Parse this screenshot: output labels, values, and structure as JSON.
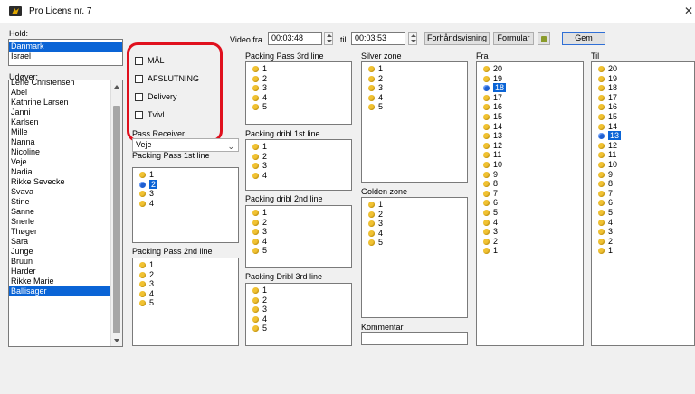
{
  "window": {
    "title": "Pro Licens nr. 7",
    "close_glyph": "✕"
  },
  "hold": {
    "label": "Hold:",
    "items": [
      "Danmark",
      "Israel"
    ],
    "selected_index": 0
  },
  "udover": {
    "label": "Udøver:",
    "items": [
      "Lene Christensen",
      "Abel",
      "Kathrine Larsen",
      "Janni",
      "Karlsen",
      "Mille",
      "Nanna",
      "Nicoline",
      "Veje",
      "Nadia",
      "Rikke Sevecke",
      "Svava",
      "Stine",
      "Sanne",
      "Snerle",
      "Thøger",
      "Sara",
      "Junge",
      "Bruun",
      "Harder",
      "Rikke Marie",
      "Ballisager"
    ],
    "selected_index": 21
  },
  "checkboxes": [
    {
      "label": "MÅL",
      "checked": false
    },
    {
      "label": "AFSLUTNING",
      "checked": false
    },
    {
      "label": "Delivery",
      "checked": false
    },
    {
      "label": "Tvivl",
      "checked": false
    }
  ],
  "pass_receiver": {
    "label": "Pass Receiver",
    "value": "Veje"
  },
  "video": {
    "from_label": "Video fra",
    "from_value": "00:03:48",
    "to_label": "til",
    "to_value": "00:03:53"
  },
  "buttons": {
    "preview": "Forhåndsvisning",
    "form": "Formular",
    "save": "Gem"
  },
  "groups": {
    "pp1": {
      "label": "Packing Pass 1st line",
      "items": [
        "1",
        "2",
        "3",
        "4"
      ],
      "selected_index": 1
    },
    "pp2": {
      "label": "Packing Pass 2nd line",
      "items": [
        "1",
        "2",
        "3",
        "4",
        "5"
      ],
      "selected_index": -1
    },
    "pp3": {
      "label": "Packing Pass 3rd line",
      "items": [
        "1",
        "2",
        "3",
        "4",
        "5"
      ],
      "selected_index": -1
    },
    "pd1": {
      "label": "Packing dribl 1st line",
      "items": [
        "1",
        "2",
        "3",
        "4"
      ],
      "selected_index": -1
    },
    "pd2": {
      "label": "Packing dribl 2nd line",
      "items": [
        "1",
        "2",
        "3",
        "4",
        "5"
      ],
      "selected_index": -1
    },
    "pd3": {
      "label": "Packing Dribl 3rd line",
      "items": [
        "1",
        "2",
        "3",
        "4",
        "5"
      ],
      "selected_index": -1
    },
    "silver": {
      "label": "Silver zone",
      "items": [
        "1",
        "2",
        "3",
        "4",
        "5"
      ],
      "selected_index": -1
    },
    "golden": {
      "label": "Golden zone",
      "items": [
        "1",
        "2",
        "3",
        "4",
        "5"
      ],
      "selected_index": -1
    },
    "fra": {
      "label": "Fra",
      "items": [
        "20",
        "19",
        "18",
        "17",
        "16",
        "15",
        "14",
        "13",
        "12",
        "11",
        "10",
        "9",
        "8",
        "7",
        "6",
        "5",
        "4",
        "3",
        "2",
        "1"
      ],
      "selected_index": 2
    },
    "til": {
      "label": "Til",
      "items": [
        "20",
        "19",
        "18",
        "17",
        "16",
        "15",
        "14",
        "13",
        "12",
        "11",
        "10",
        "9",
        "8",
        "7",
        "6",
        "5",
        "4",
        "3",
        "2",
        "1"
      ],
      "selected_index": 7
    }
  },
  "comment": {
    "label": "Kommentar",
    "value": ""
  },
  "highlight_color": "#e0101e"
}
